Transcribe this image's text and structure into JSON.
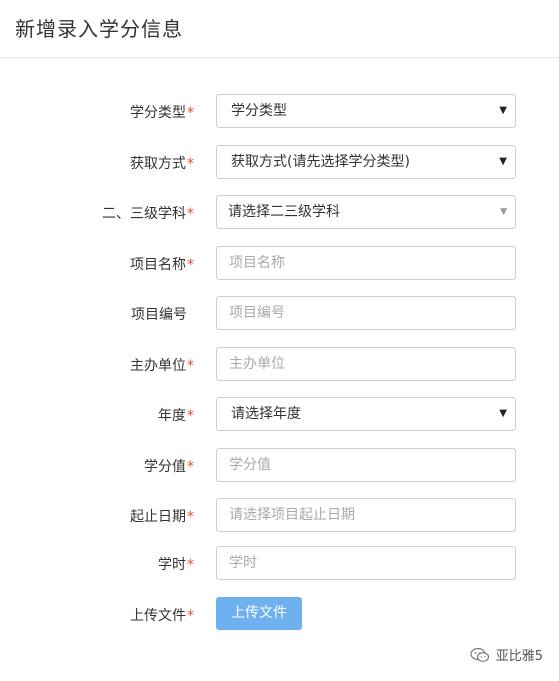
{
  "page": {
    "title": "新增录入学分信息"
  },
  "form": {
    "credit_type": {
      "label": "学分类型",
      "required": "*",
      "value": "学分类型"
    },
    "acquire_method": {
      "label": "获取方式",
      "required": "*",
      "value": "获取方式(请先选择学分类型)"
    },
    "subject": {
      "label": "二、三级学科",
      "required": "*",
      "value": "请选择二三级学科"
    },
    "project_name": {
      "label": "项目名称",
      "required": "*",
      "placeholder": "项目名称"
    },
    "project_code": {
      "label": "项目编号",
      "placeholder": "项目编号"
    },
    "organizer": {
      "label": "主办单位",
      "required": "*",
      "placeholder": "主办单位"
    },
    "year": {
      "label": "年度",
      "required": "*",
      "value": "请选择年度"
    },
    "credit_value": {
      "label": "学分值",
      "required": "*",
      "placeholder": "学分值"
    },
    "date_range": {
      "label": "起止日期",
      "required": "*",
      "placeholder": "请选择项目起止日期"
    },
    "hours": {
      "label": "学时",
      "required": "*",
      "placeholder": "学时"
    },
    "upload": {
      "label": "上传文件",
      "required": "*",
      "button": "上传文件"
    }
  },
  "watermark": {
    "text": "亚比雅5",
    "icon": "wechat-icon"
  },
  "colors": {
    "required": "#e94c3a",
    "upload_button": "#6fb1ee"
  }
}
